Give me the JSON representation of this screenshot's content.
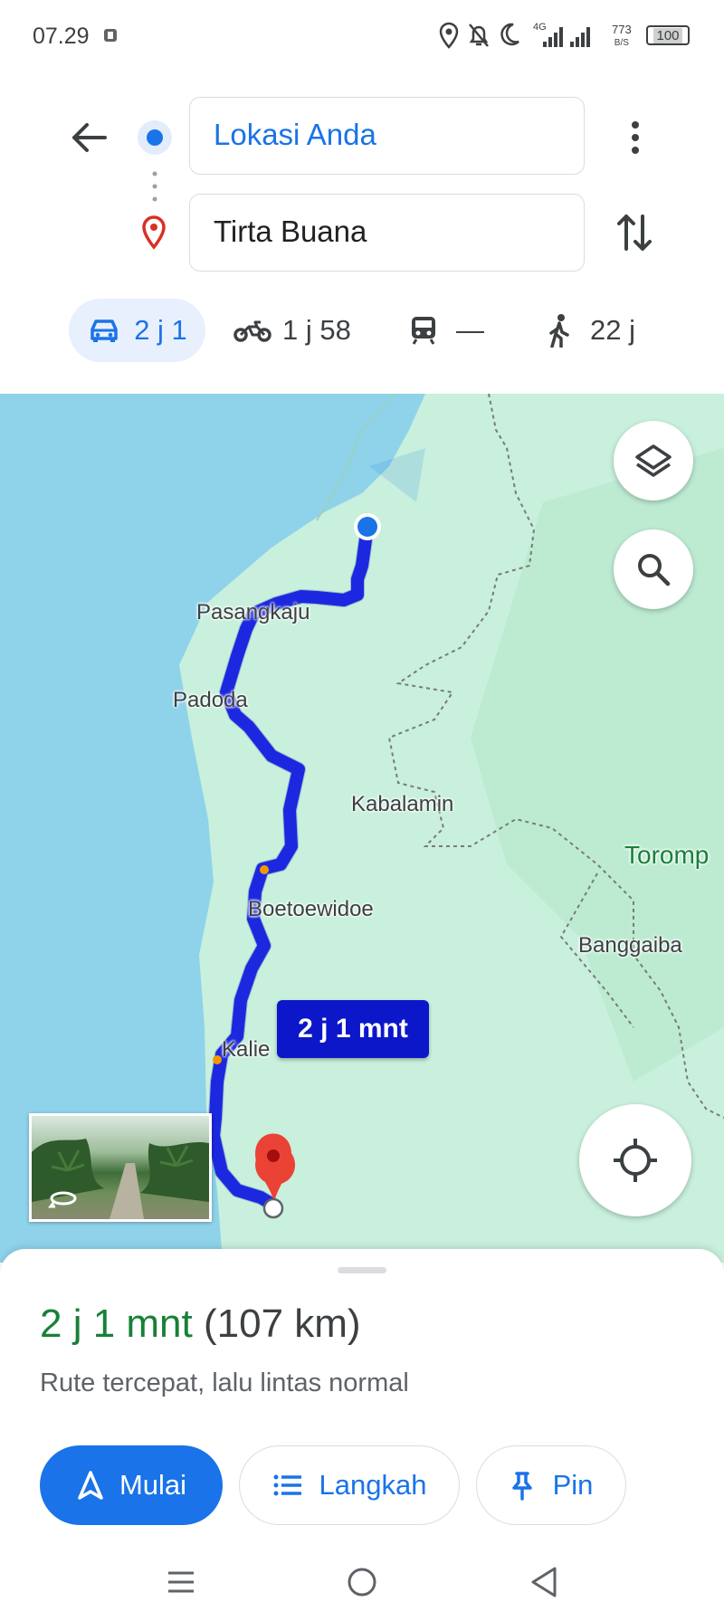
{
  "status_bar": {
    "time": "07.29",
    "network": "4G",
    "speed_value": "773",
    "speed_unit": "B/S",
    "battery": "100"
  },
  "directions": {
    "origin": "Lokasi Anda",
    "destination": "Tirta Buana"
  },
  "modes": [
    {
      "name": "car",
      "time": "2 j 1",
      "selected": true
    },
    {
      "name": "motorcycle",
      "time": "1 j 58"
    },
    {
      "name": "transit",
      "time": "—"
    },
    {
      "name": "walk",
      "time": "22 j"
    }
  ],
  "map": {
    "labels": {
      "pasangkaju": "Pasangkaju",
      "padoda": "Padoda",
      "kabalamin": "Kabalamin",
      "boetoewidoe": "Boetoewidoe",
      "torompe": "Toromp",
      "banggaiba": "Banggaiba",
      "kalie": "Kalie"
    },
    "route_duration_badge": "2 j 1 mnt"
  },
  "route_summary": {
    "duration": "2 j 1 mnt",
    "distance": "(107 km)",
    "description": "Rute tercepat, lalu lintas normal"
  },
  "actions": {
    "start": "Mulai",
    "steps": "Langkah",
    "pin": "Pin"
  },
  "colors": {
    "accent": "#1a73e8",
    "route": "#1030e8",
    "duration_green": "#188038",
    "water": "#8fd3ea",
    "land": "#c8f0dc"
  }
}
